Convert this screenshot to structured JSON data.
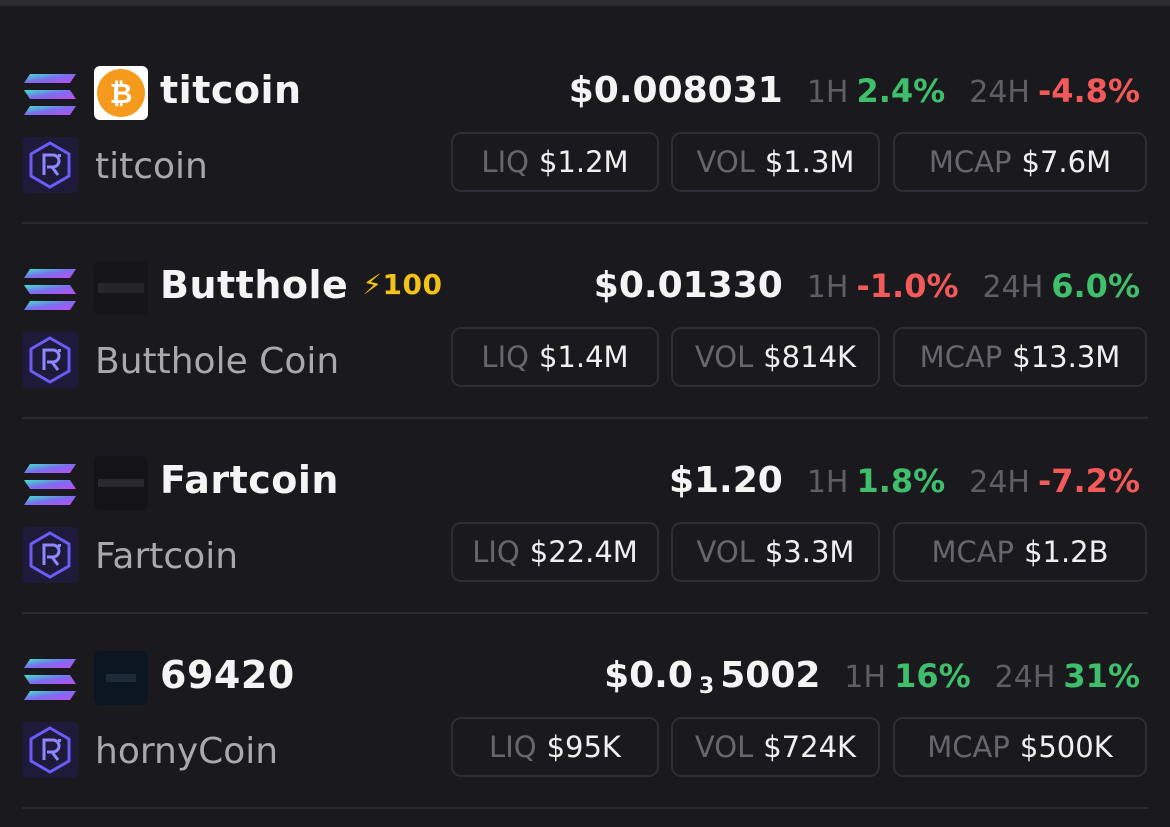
{
  "tokens": [
    {
      "symbol": "titcoin",
      "boost": "",
      "name": "titcoin",
      "price_main": "$0.008031",
      "price_sub": "",
      "price_rest": "",
      "h1_label": "1H",
      "h1": "2.4%",
      "h1_dir": "pos",
      "h24_label": "24H",
      "h24": "-4.8%",
      "h24_dir": "neg",
      "liq_label": "LIQ",
      "liq": "$1.2M",
      "vol_label": "VOL",
      "vol": "$1.3M",
      "mcap_label": "MCAP",
      "mcap": "$7.6M",
      "logo": "titcoin-orange-logo"
    },
    {
      "symbol": "Butthole",
      "boost": "⚡100",
      "name": "Butthole Coin",
      "price_main": "$0.01330",
      "price_sub": "",
      "price_rest": "",
      "h1_label": "1H",
      "h1": "-1.0%",
      "h1_dir": "neg",
      "h24_label": "24H",
      "h24": "6.0%",
      "h24_dir": "pos",
      "liq_label": "LIQ",
      "liq": "$1.4M",
      "vol_label": "VOL",
      "vol": "$814K",
      "mcap_label": "MCAP",
      "mcap": "$13.3M",
      "logo": "butthole-dark-logo"
    },
    {
      "symbol": "Fartcoin",
      "boost": "",
      "name": "Fartcoin",
      "price_main": "$1.20",
      "price_sub": "",
      "price_rest": "",
      "h1_label": "1H",
      "h1": "1.8%",
      "h1_dir": "pos",
      "h24_label": "24H",
      "h24": "-7.2%",
      "h24_dir": "neg",
      "liq_label": "LIQ",
      "liq": "$22.4M",
      "vol_label": "VOL",
      "vol": "$3.3M",
      "mcap_label": "MCAP",
      "mcap": "$1.2B",
      "logo": "fartcoin-dark-logo"
    },
    {
      "symbol": "69420",
      "boost": "",
      "name": "hornyCoin",
      "price_main": "$0.0",
      "price_sub": "3",
      "price_rest": "5002",
      "h1_label": "1H",
      "h1": "16%",
      "h1_dir": "pos",
      "h24_label": "24H",
      "h24": "31%",
      "h24_dir": "pos",
      "liq_label": "LIQ",
      "liq": "$95K",
      "vol_label": "VOL",
      "vol": "$724K",
      "mcap_label": "MCAP",
      "mcap": "$500K",
      "logo": "69420-dark-logo"
    }
  ],
  "icons": {
    "chain": "solana-icon",
    "dex": "raydium-icon"
  },
  "colors": {
    "positive": "#3fbf6b",
    "negative": "#f25a5a",
    "boost": "#f2c21b",
    "background": "#1a191e"
  }
}
